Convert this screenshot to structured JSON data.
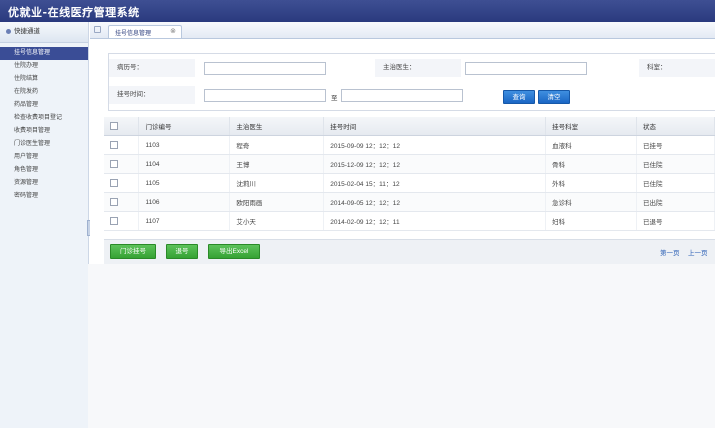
{
  "app": {
    "title": "优就业-在线医疗管理系统"
  },
  "sidebar": {
    "title": "快捷通道",
    "items": [
      {
        "label": "挂号信息管理",
        "active": true
      },
      {
        "label": "住院办理"
      },
      {
        "label": "住院结算"
      },
      {
        "label": "在院发药"
      },
      {
        "label": "药品管理"
      },
      {
        "label": "检查收费项目登记"
      },
      {
        "label": "收费项目管理"
      },
      {
        "label": "门诊医生管理"
      },
      {
        "label": "用户管理"
      },
      {
        "label": "角色管理"
      },
      {
        "label": "资源管理"
      },
      {
        "label": "密码管理"
      }
    ]
  },
  "tabs": {
    "active_label": "挂号信息管理",
    "close_glyph": "⊗"
  },
  "filters": {
    "case_no_label": "病历号：",
    "doctor_label": "主治医生：",
    "dept_label": "科室：",
    "reg_time_label": "挂号时间：",
    "to_label": "至",
    "case_no_value": "",
    "doctor_value": "",
    "time_from_value": "",
    "time_to_value": "",
    "query_button": "查询",
    "clear_button": "清空"
  },
  "table": {
    "headers": [
      "门诊编号",
      "主治医生",
      "挂号时间",
      "挂号科室",
      "状态"
    ],
    "rows": [
      {
        "id": "1103",
        "doctor": "程奇",
        "time": "2015-09-09 12：12：12",
        "dept": "血液科",
        "status": "已挂号"
      },
      {
        "id": "1104",
        "doctor": "王博",
        "time": "2015-12-09 12：12：12",
        "dept": "骨科",
        "status": "已住院"
      },
      {
        "id": "1105",
        "doctor": "沈莉川",
        "time": "2015-02-04 15：11：12",
        "dept": "外科",
        "status": "已住院"
      },
      {
        "id": "1106",
        "doctor": "欧阳雨画",
        "time": "2014-09-05 12：12：12",
        "dept": "急诊科",
        "status": "已出院"
      },
      {
        "id": "1107",
        "doctor": "艾小天",
        "time": "2014-02-09 12：12：11",
        "dept": "妇科",
        "status": "已退号"
      }
    ]
  },
  "actions": {
    "outpatient_register": "门诊挂号",
    "refund_register": "退号",
    "export_excel": "导出Excel",
    "first_page": "第一页",
    "prev_page": "上一页"
  }
}
